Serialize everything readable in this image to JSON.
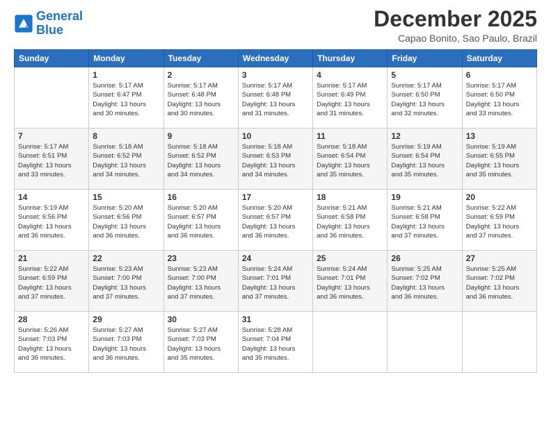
{
  "header": {
    "logo_line1": "General",
    "logo_line2": "Blue",
    "month_title": "December 2025",
    "location": "Capao Bonito, Sao Paulo, Brazil"
  },
  "weekdays": [
    "Sunday",
    "Monday",
    "Tuesday",
    "Wednesday",
    "Thursday",
    "Friday",
    "Saturday"
  ],
  "weeks": [
    [
      {
        "day": "",
        "info": ""
      },
      {
        "day": "1",
        "info": "Sunrise: 5:17 AM\nSunset: 6:47 PM\nDaylight: 13 hours\nand 30 minutes."
      },
      {
        "day": "2",
        "info": "Sunrise: 5:17 AM\nSunset: 6:48 PM\nDaylight: 13 hours\nand 30 minutes."
      },
      {
        "day": "3",
        "info": "Sunrise: 5:17 AM\nSunset: 6:48 PM\nDaylight: 13 hours\nand 31 minutes."
      },
      {
        "day": "4",
        "info": "Sunrise: 5:17 AM\nSunset: 6:49 PM\nDaylight: 13 hours\nand 31 minutes."
      },
      {
        "day": "5",
        "info": "Sunrise: 5:17 AM\nSunset: 6:50 PM\nDaylight: 13 hours\nand 32 minutes."
      },
      {
        "day": "6",
        "info": "Sunrise: 5:17 AM\nSunset: 6:50 PM\nDaylight: 13 hours\nand 33 minutes."
      }
    ],
    [
      {
        "day": "7",
        "info": "Sunrise: 5:17 AM\nSunset: 6:51 PM\nDaylight: 13 hours\nand 33 minutes."
      },
      {
        "day": "8",
        "info": "Sunrise: 5:18 AM\nSunset: 6:52 PM\nDaylight: 13 hours\nand 34 minutes."
      },
      {
        "day": "9",
        "info": "Sunrise: 5:18 AM\nSunset: 6:52 PM\nDaylight: 13 hours\nand 34 minutes."
      },
      {
        "day": "10",
        "info": "Sunrise: 5:18 AM\nSunset: 6:53 PM\nDaylight: 13 hours\nand 34 minutes."
      },
      {
        "day": "11",
        "info": "Sunrise: 5:18 AM\nSunset: 6:54 PM\nDaylight: 13 hours\nand 35 minutes."
      },
      {
        "day": "12",
        "info": "Sunrise: 5:19 AM\nSunset: 6:54 PM\nDaylight: 13 hours\nand 35 minutes."
      },
      {
        "day": "13",
        "info": "Sunrise: 5:19 AM\nSunset: 6:55 PM\nDaylight: 13 hours\nand 35 minutes."
      }
    ],
    [
      {
        "day": "14",
        "info": "Sunrise: 5:19 AM\nSunset: 6:56 PM\nDaylight: 13 hours\nand 36 minutes."
      },
      {
        "day": "15",
        "info": "Sunrise: 5:20 AM\nSunset: 6:56 PM\nDaylight: 13 hours\nand 36 minutes."
      },
      {
        "day": "16",
        "info": "Sunrise: 5:20 AM\nSunset: 6:57 PM\nDaylight: 13 hours\nand 36 minutes."
      },
      {
        "day": "17",
        "info": "Sunrise: 5:20 AM\nSunset: 6:57 PM\nDaylight: 13 hours\nand 36 minutes."
      },
      {
        "day": "18",
        "info": "Sunrise: 5:21 AM\nSunset: 6:58 PM\nDaylight: 13 hours\nand 36 minutes."
      },
      {
        "day": "19",
        "info": "Sunrise: 5:21 AM\nSunset: 6:58 PM\nDaylight: 13 hours\nand 37 minutes."
      },
      {
        "day": "20",
        "info": "Sunrise: 5:22 AM\nSunset: 6:59 PM\nDaylight: 13 hours\nand 37 minutes."
      }
    ],
    [
      {
        "day": "21",
        "info": "Sunrise: 5:22 AM\nSunset: 6:59 PM\nDaylight: 13 hours\nand 37 minutes."
      },
      {
        "day": "22",
        "info": "Sunrise: 5:23 AM\nSunset: 7:00 PM\nDaylight: 13 hours\nand 37 minutes."
      },
      {
        "day": "23",
        "info": "Sunrise: 5:23 AM\nSunset: 7:00 PM\nDaylight: 13 hours\nand 37 minutes."
      },
      {
        "day": "24",
        "info": "Sunrise: 5:24 AM\nSunset: 7:01 PM\nDaylight: 13 hours\nand 37 minutes."
      },
      {
        "day": "25",
        "info": "Sunrise: 5:24 AM\nSunset: 7:01 PM\nDaylight: 13 hours\nand 36 minutes."
      },
      {
        "day": "26",
        "info": "Sunrise: 5:25 AM\nSunset: 7:02 PM\nDaylight: 13 hours\nand 36 minutes."
      },
      {
        "day": "27",
        "info": "Sunrise: 5:25 AM\nSunset: 7:02 PM\nDaylight: 13 hours\nand 36 minutes."
      }
    ],
    [
      {
        "day": "28",
        "info": "Sunrise: 5:26 AM\nSunset: 7:03 PM\nDaylight: 13 hours\nand 36 minutes."
      },
      {
        "day": "29",
        "info": "Sunrise: 5:27 AM\nSunset: 7:03 PM\nDaylight: 13 hours\nand 36 minutes."
      },
      {
        "day": "30",
        "info": "Sunrise: 5:27 AM\nSunset: 7:03 PM\nDaylight: 13 hours\nand 35 minutes."
      },
      {
        "day": "31",
        "info": "Sunrise: 5:28 AM\nSunset: 7:04 PM\nDaylight: 13 hours\nand 35 minutes."
      },
      {
        "day": "",
        "info": ""
      },
      {
        "day": "",
        "info": ""
      },
      {
        "day": "",
        "info": ""
      }
    ]
  ]
}
